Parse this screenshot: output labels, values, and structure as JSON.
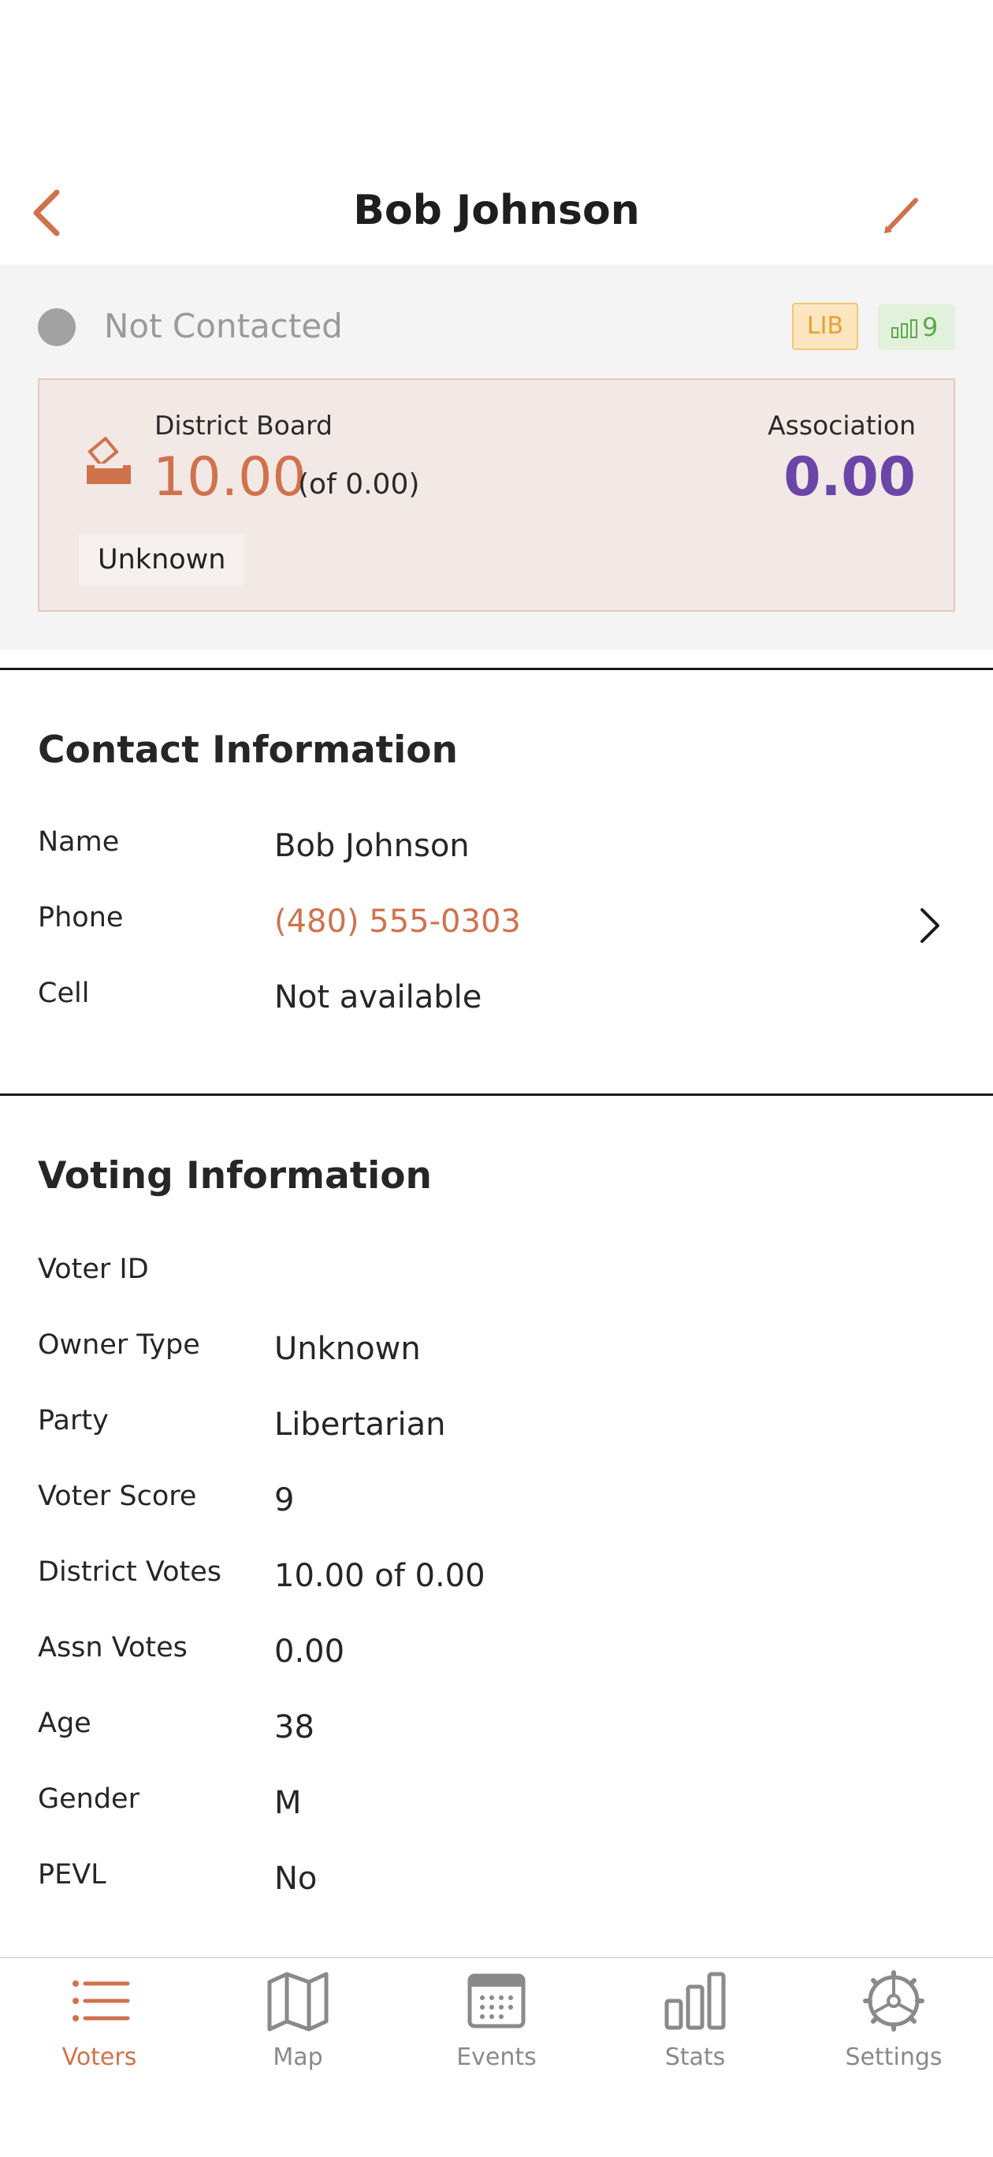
{
  "header": {
    "title": "Bob Johnson"
  },
  "status": {
    "label": "Not Contacted",
    "party_badge": "LIB",
    "score_badge": "9"
  },
  "vote_card": {
    "district_label": "District Board",
    "district_value": "10.00",
    "district_of": "(of 0.00)",
    "association_label": "Association",
    "association_value": "0.00",
    "owner_type_chip": "Unknown"
  },
  "contact": {
    "title": "Contact Information",
    "rows": [
      {
        "label": "Name",
        "value": "Bob Johnson"
      },
      {
        "label": "Phone",
        "value": "(480) 555-0303"
      },
      {
        "label": "Cell",
        "value": "Not available"
      }
    ]
  },
  "voting": {
    "title": "Voting Information",
    "rows": [
      {
        "label": "Voter ID",
        "value": ""
      },
      {
        "label": "Owner Type",
        "value": "Unknown"
      },
      {
        "label": "Party",
        "value": "Libertarian"
      },
      {
        "label": "Voter Score",
        "value": "9"
      },
      {
        "label": "District Votes",
        "value": "10.00 of 0.00"
      },
      {
        "label": "Assn Votes",
        "value": "0.00"
      },
      {
        "label": "Age",
        "value": "38"
      },
      {
        "label": "Gender",
        "value": "M"
      },
      {
        "label": "PEVL",
        "value": "No"
      }
    ]
  },
  "tabs": [
    {
      "label": "Voters",
      "icon": "list-icon",
      "active": true
    },
    {
      "label": "Map",
      "icon": "map-icon",
      "active": false
    },
    {
      "label": "Events",
      "icon": "calendar-icon",
      "active": false
    },
    {
      "label": "Stats",
      "icon": "bar-chart-icon",
      "active": false
    },
    {
      "label": "Settings",
      "icon": "gear-icon",
      "active": false
    }
  ],
  "colors": {
    "accent": "#d0724c",
    "association": "#6b45a8",
    "status_dot": "#a2a2a2",
    "party_badge_bg": "#fbe6c0",
    "score_badge_bg": "#e2f1dc"
  }
}
